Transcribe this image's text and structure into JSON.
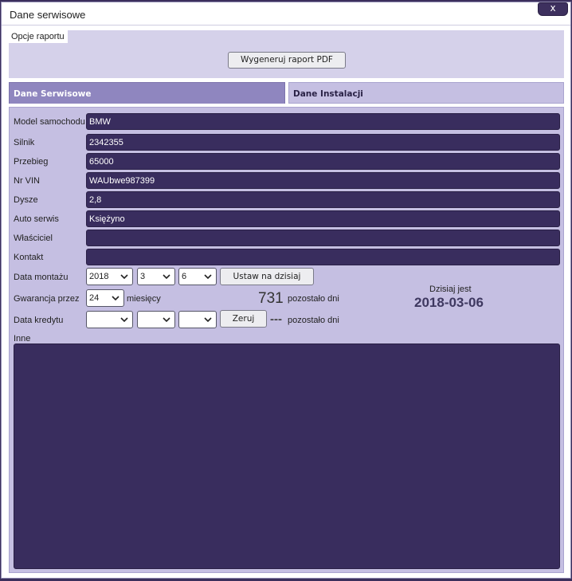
{
  "dialog": {
    "title": "Dane serwisowe",
    "close_label": "x"
  },
  "report_options": {
    "legend": "Opcje raportu",
    "generate_pdf_label": "Wygeneruj raport PDF"
  },
  "tabs": [
    {
      "label": "Dane Serwisowe",
      "active": true
    },
    {
      "label": "Dane Instalacji",
      "active": false
    }
  ],
  "fields": {
    "model": {
      "label": "Model samochodu",
      "value": "BMW"
    },
    "engine": {
      "label": "Silnik",
      "value": "2342355"
    },
    "mileage": {
      "label": "Przebieg",
      "value": "65000"
    },
    "vin": {
      "label": "Nr VIN",
      "value": "WAUbwe987399"
    },
    "nozzles": {
      "label": "Dysze",
      "value": "2,8"
    },
    "service": {
      "label": "Auto serwis",
      "value": "Księżyno"
    },
    "owner": {
      "label": "Właściciel",
      "value": ""
    },
    "contact": {
      "label": "Kontakt",
      "value": ""
    }
  },
  "install_date": {
    "label": "Data montażu",
    "year": "2018",
    "month": "3",
    "day": "6",
    "set_today_label": "Ustaw na dzisiaj"
  },
  "warranty": {
    "label": "Gwarancja przez",
    "months": "24",
    "months_unit": "miesięcy",
    "days_left": "731",
    "days_left_suffix": "pozostało dni"
  },
  "credit_date": {
    "label": "Data kredytu",
    "year": "",
    "month": "",
    "day": "",
    "reset_label": "Zeruj",
    "days_left": "---",
    "days_left_suffix": "pozostało dni"
  },
  "today": {
    "label": "Dzisiaj jest",
    "date": "2018-03-06"
  },
  "notes": {
    "label": "Inne",
    "value": ""
  },
  "colors": {
    "field_bg": "#392d5e",
    "panel_bg": "#c5bfe2",
    "active_tab": "#8f86bf"
  }
}
